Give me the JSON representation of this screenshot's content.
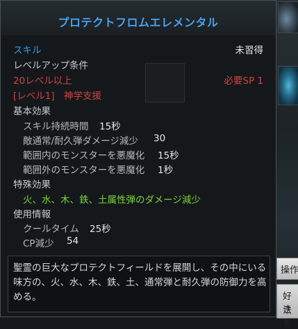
{
  "tooltip": {
    "title": "プロテクトフロムエレメンタル",
    "skill_label": "スキル",
    "status": "未習得",
    "levelup_label": "レベルアップ条件",
    "req_level": "20レベル以上",
    "req_sp": "必要SP 1",
    "level_tag": "[レベル1]",
    "job": "神学支援",
    "basic_effects_label": "基本効果",
    "basic_effects": [
      {
        "label": "スキル持続時間",
        "value": "15秒"
      },
      {
        "label": "敵通常/耐久弾ダメージ減少",
        "value": "30"
      },
      {
        "label": "範囲内のモンスターを悪魔化",
        "value": "15秒"
      },
      {
        "label": "範囲外のモンスターを悪魔化",
        "value": "1秒"
      }
    ],
    "special_effects_label": "特殊効果",
    "special_effect": "火、水、木、鉄、土属性弾のダメージ減少",
    "usage_label": "使用情報",
    "usage": [
      {
        "label": "クールタイム",
        "value": "25秒"
      },
      {
        "label": "CP減少",
        "value": "54"
      }
    ],
    "description": "聖霊の巨大なプロテクトフィールドを展開し、その中にいる味方の、火、水、木、鉄、土、通常弾と耐久弾の防御力を高める。"
  },
  "background": {
    "button_a": "操作",
    "button_b_line1": "好き",
    "button_b_line2": "法を"
  }
}
